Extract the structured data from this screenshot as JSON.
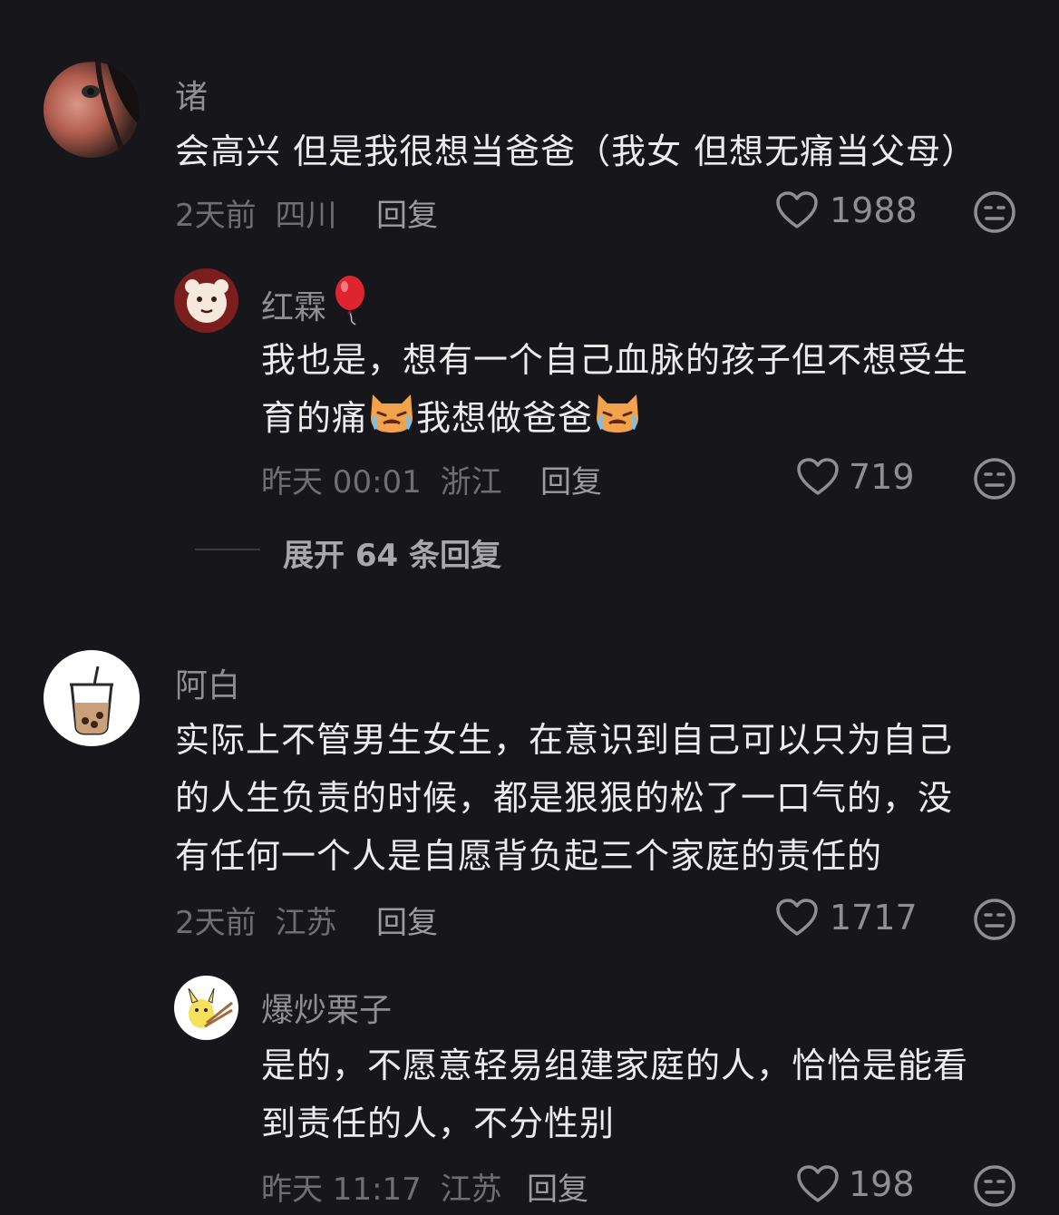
{
  "comments": [
    {
      "user": "诸",
      "text": "会高兴 但是我很想当爸爸（我女 但想无痛当父母）",
      "time": "2天前",
      "location": "四川",
      "reply_label": "回复",
      "likes": "1988",
      "replies": [
        {
          "user": "红霖",
          "user_emoji": "balloon-icon",
          "text_line1": "我也是，想有一个自己血脉的孩子但不想受生",
          "text_line2a": "育的痛",
          "text_line2b": "我想做爸爸",
          "emoji": "crying-cat-icon",
          "time": "昨天 00:01",
          "location": "浙江",
          "reply_label": "回复",
          "likes": "719"
        }
      ],
      "expand_label": "展开 64 条回复"
    },
    {
      "user": "阿白",
      "text_lines": [
        "实际上不管男生女生，在意识到自己可以只为自己",
        "的人生负责的时候，都是狠狠的松了一口气的，没",
        "有任何一个人是自愿背负起三个家庭的责任的"
      ],
      "time": "2天前",
      "location": "江苏",
      "reply_label": "回复",
      "likes": "1717",
      "replies": [
        {
          "user": "爆炒栗子",
          "text_lines": [
            "是的，不愿意轻易组建家庭的人，恰恰是能看",
            "到责任的人，不分性别"
          ],
          "time": "昨天 11:17",
          "location": "江苏",
          "reply_label": "回复",
          "likes": "198"
        }
      ]
    }
  ],
  "colors": {
    "background": "#17161b",
    "text": "#ececec",
    "muted": "#8f8e93",
    "balloon": "#e0242f"
  }
}
